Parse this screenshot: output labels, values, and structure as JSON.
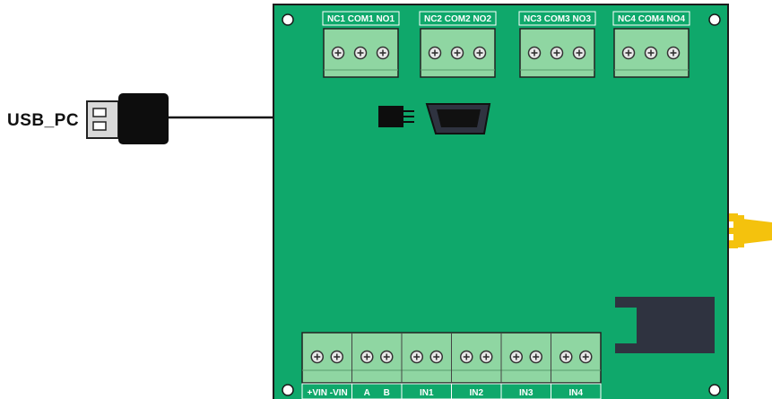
{
  "usb_label": "USB_PC",
  "relay_groups": [
    [
      "NC1",
      "COM1",
      "NO1"
    ],
    [
      "NC2",
      "COM2",
      "NO2"
    ],
    [
      "NC3",
      "COM3",
      "NO3"
    ],
    [
      "NC4",
      "COM4",
      "NO4"
    ]
  ],
  "bottom_labels": [
    "+VIN",
    "-VIN",
    "A",
    "B",
    "IN1",
    "IN2",
    "IN3",
    "IN4"
  ],
  "colors": {
    "board": "#0fa86b",
    "board_outline": "#1b1b1b",
    "terminal": "#8fd6a2",
    "label_text": "#ffffff",
    "antenna": "#f4c20d",
    "sim_block": "#2f3340"
  }
}
